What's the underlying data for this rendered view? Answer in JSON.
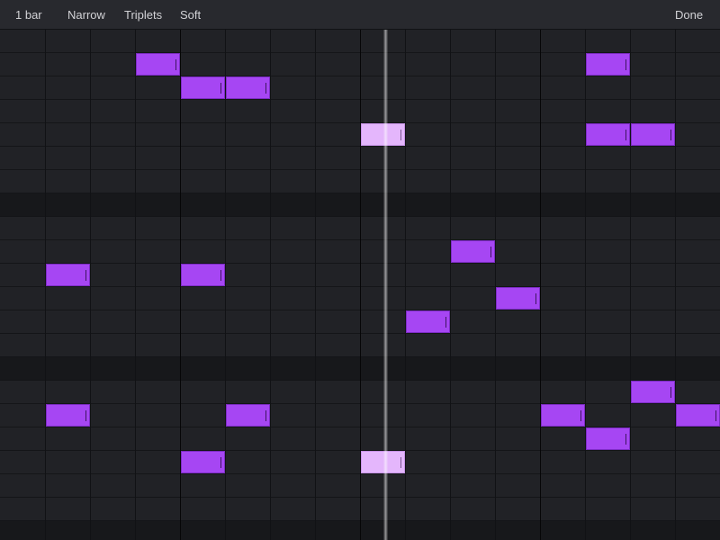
{
  "toolbar": {
    "length_label": "1 bar",
    "narrow_label": "Narrow",
    "triplets_label": "Triplets",
    "soft_label": "Soft",
    "done_label": "Done"
  },
  "editor": {
    "steps": 16,
    "rows": 22,
    "playhead_step": 8.55,
    "note_color": "#a646f3",
    "active_note_color": "#e4b6fc",
    "notes": [
      {
        "row": 1,
        "step": 3,
        "len": 1,
        "active": false
      },
      {
        "row": 1,
        "step": 13,
        "len": 1,
        "active": false
      },
      {
        "row": 2,
        "step": 4,
        "len": 1,
        "active": false
      },
      {
        "row": 2,
        "step": 5,
        "len": 1,
        "active": false
      },
      {
        "row": 4,
        "step": 8,
        "len": 1,
        "active": true
      },
      {
        "row": 4,
        "step": 13,
        "len": 1,
        "active": false
      },
      {
        "row": 4,
        "step": 14,
        "len": 1,
        "active": false
      },
      {
        "row": 9,
        "step": 10,
        "len": 1,
        "active": false
      },
      {
        "row": 10,
        "step": 1,
        "len": 1,
        "active": false
      },
      {
        "row": 10,
        "step": 4,
        "len": 1,
        "active": false
      },
      {
        "row": 11,
        "step": 11,
        "len": 1,
        "active": false
      },
      {
        "row": 12,
        "step": 9,
        "len": 1,
        "active": false
      },
      {
        "row": 15,
        "step": 14,
        "len": 1,
        "active": false
      },
      {
        "row": 16,
        "step": 1,
        "len": 1,
        "active": false
      },
      {
        "row": 16,
        "step": 5,
        "len": 1,
        "active": false
      },
      {
        "row": 16,
        "step": 12,
        "len": 1,
        "active": false
      },
      {
        "row": 16,
        "step": 15,
        "len": 1,
        "active": false
      },
      {
        "row": 17,
        "step": 13,
        "len": 1,
        "active": false
      },
      {
        "row": 18,
        "step": 4,
        "len": 1,
        "active": false
      },
      {
        "row": 18,
        "step": 8,
        "len": 1,
        "active": true
      }
    ]
  }
}
